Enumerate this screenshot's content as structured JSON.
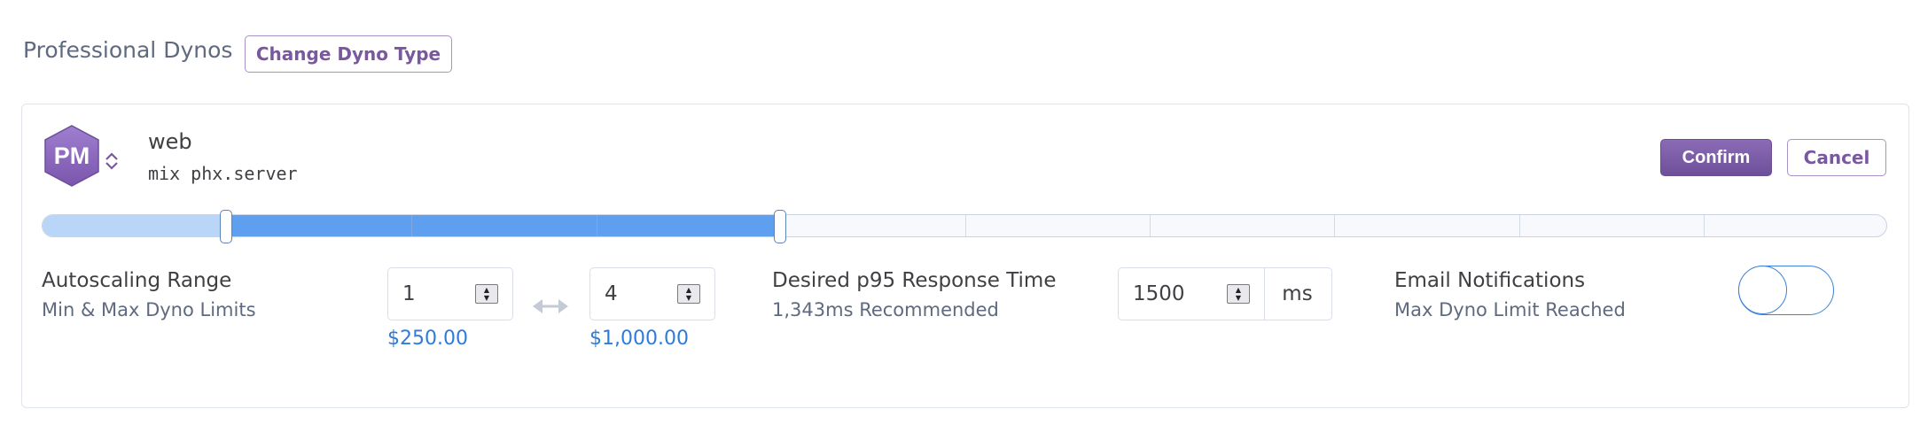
{
  "header": {
    "section_title": "Professional Dynos",
    "change_button": "Change Dyno Type"
  },
  "dyno": {
    "logo_text": "PM",
    "name": "web",
    "command": "mix phx.server",
    "confirm_label": "Confirm",
    "cancel_label": "Cancel"
  },
  "autoscaling": {
    "title": "Autoscaling Range",
    "subtitle": "Min & Max Dyno Limits",
    "min": "1",
    "max": "4",
    "min_price": "$250.00",
    "max_price": "$1,000.00",
    "slider_steps": 10,
    "slider_min_value": 1,
    "slider_max_value": 4
  },
  "response_time": {
    "title": "Desired p95 Response Time",
    "subtitle": "1,343ms Recommended",
    "value": "1500",
    "unit": "ms"
  },
  "notifications": {
    "title": "Email Notifications",
    "subtitle": "Max Dyno Limit Reached",
    "enabled": false
  },
  "colors": {
    "brand_purple": "#79589f",
    "slider_fill": "#5f9ff0",
    "slider_light": "#b9d5f7",
    "price_blue": "#2f7bdc",
    "toggle_blue": "#3c82d8"
  },
  "icons": {
    "logo": "dyno-hexagon-icon",
    "expand": "chevron-up-down-icon",
    "range": "double-arrow-icon",
    "spinner": "spinner-arrows-icon"
  }
}
